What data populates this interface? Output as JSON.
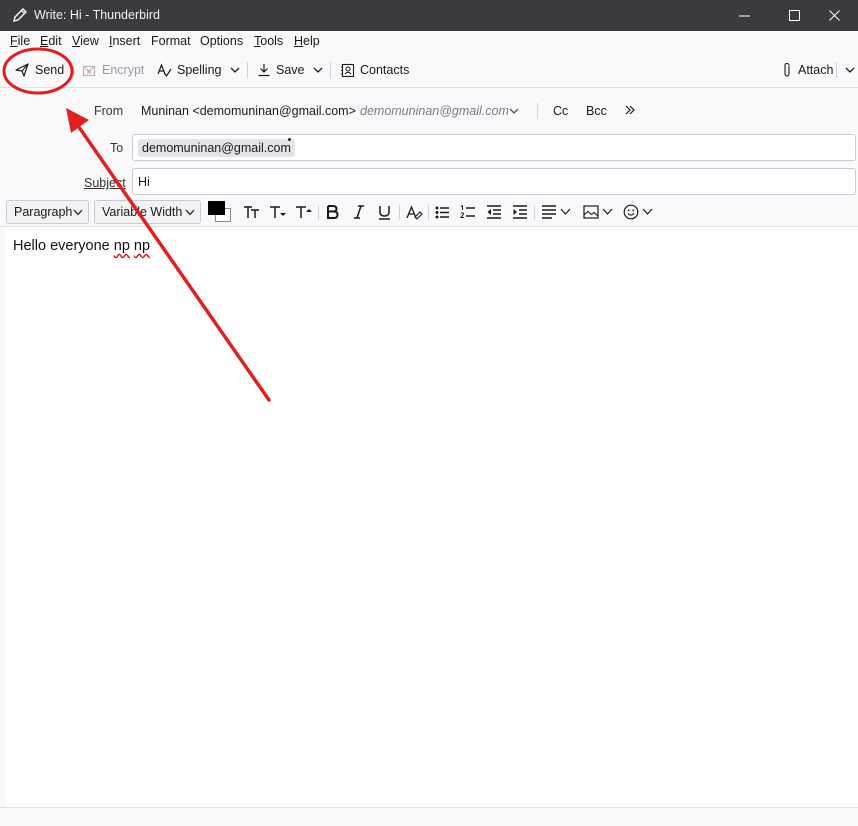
{
  "window": {
    "title": "Write: Hi - Thunderbird",
    "app_icon": "pencil-icon"
  },
  "menubar": {
    "items": [
      {
        "accel": "F",
        "rest": "ile"
      },
      {
        "accel": "E",
        "rest": "dit"
      },
      {
        "accel": "V",
        "rest": "iew"
      },
      {
        "accel": "I",
        "rest": "nsert"
      },
      {
        "accel": "",
        "rest": "Format"
      },
      {
        "accel": "",
        "rest": "Options"
      },
      {
        "accel": "T",
        "rest": "ools"
      },
      {
        "accel": "H",
        "rest": "elp"
      }
    ]
  },
  "toolbar": {
    "send_label": "Send",
    "encrypt_label": "Encrypt",
    "spelling_label": "Spelling",
    "save_label": "Save",
    "contacts_label": "Contacts",
    "attach_label": "Attach"
  },
  "headers": {
    "from_label": "From",
    "from_value": "Muninan <demomuninan@gmail.com>",
    "from_alt": "demomuninan@gmail.com",
    "cc_label": "Cc",
    "bcc_label": "Bcc",
    "to_label": "To",
    "to_recipients": [
      "demomuninan@gmail.com"
    ],
    "subject_label": "Subject",
    "subject_value": "Hi"
  },
  "format": {
    "paragraph_label": "Paragraph",
    "font_label": "Variable Width",
    "text_color": "#000000",
    "bg_color": "#ffffff"
  },
  "message": {
    "text_plain": "Hello everyone ",
    "text_misspelled_1": "np",
    "text_space": " ",
    "text_misspelled_2": "np"
  },
  "annotation": {
    "color": "#e0201f",
    "target": "send-button"
  }
}
